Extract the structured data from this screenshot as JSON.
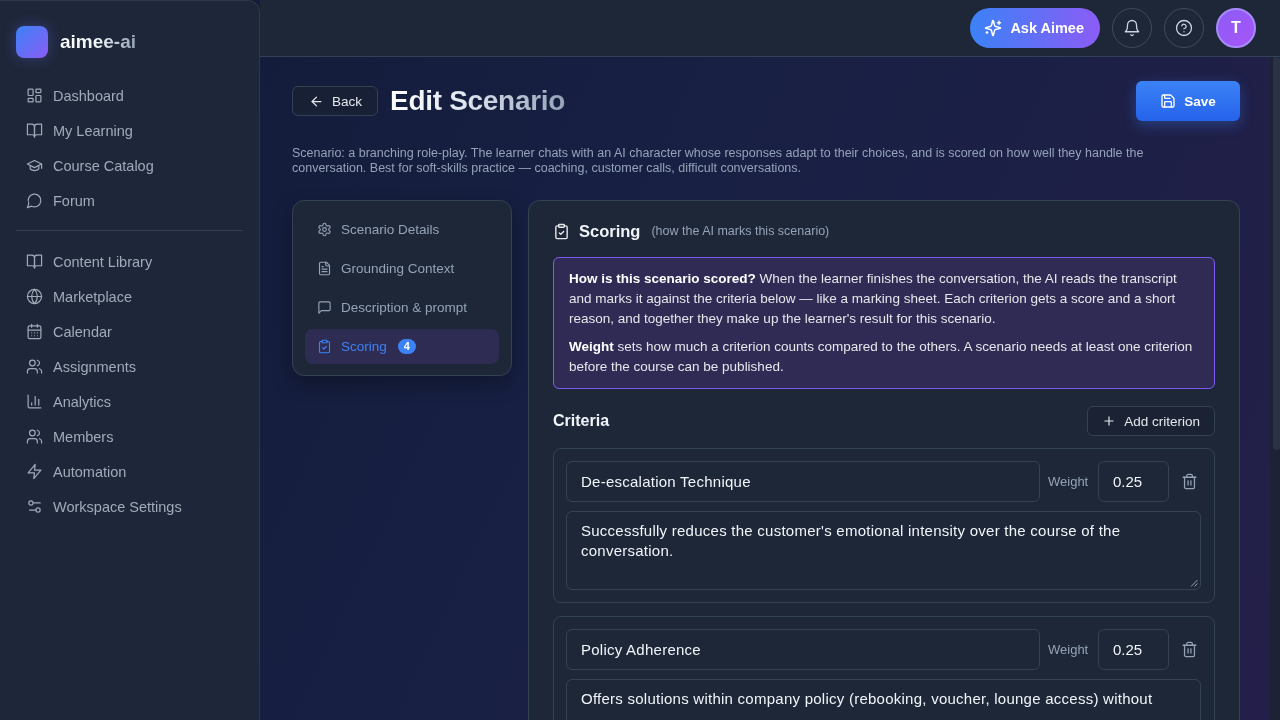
{
  "sidebar": {
    "brand": "aimee-ai",
    "sections": [
      {
        "items": [
          {
            "label": "Dashboard",
            "selected": false
          },
          {
            "label": "My Learning",
            "selected": false
          },
          {
            "label": "Course Catalog",
            "selected": false
          },
          {
            "label": "Forum",
            "selected": false
          }
        ]
      },
      {
        "items": [
          {
            "label": "Content Library",
            "selected": false
          },
          {
            "label": "Marketplace",
            "selected": false
          },
          {
            "label": "Calendar",
            "selected": false
          },
          {
            "label": "Assignments",
            "selected": false
          },
          {
            "label": "Analytics",
            "selected": false
          },
          {
            "label": "Members",
            "selected": false
          },
          {
            "label": "Automation",
            "selected": false
          },
          {
            "label": "Workspace Settings",
            "selected": false
          }
        ]
      }
    ]
  },
  "top_bar": {
    "ask_button": "Ask Aimee",
    "avatar": "T"
  },
  "header": {
    "back_button": "Back",
    "title": "Edit Scenario",
    "save_button": "Save",
    "description": "Scenario: a branching role-play. The learner chats with an AI character whose responses adapt to their choices, and is scored on how well they handle the conversation. Best for soft-skills practice — coaching, customer calls, difficult conversations."
  },
  "section_nav": {
    "items": [
      {
        "label": "Scenario Details",
        "selected": false
      },
      {
        "label": "Grounding Context",
        "selected": false
      },
      {
        "label": "Description & prompt",
        "selected": false
      },
      {
        "label": "Scoring",
        "selected": true,
        "badge": "4"
      }
    ]
  },
  "scoring": {
    "title": "Scoring",
    "subtitle": "(how the AI marks this scenario)",
    "info": [
      "**How is this scenario scored?** When the learner finishes the conversation, the AI reads the transcript and marks it against the criteria below — like a marking sheet. Each criterion gets a score and a short reason, and together they make up the learner's result for this scenario.",
      "**Weight** sets how much a criterion counts compared to the others. A scenario needs at least one criterion before the course can be published."
    ],
    "criteria_heading": "Criteria",
    "add_button": "Add criterion",
    "criteria": [
      {
        "name": "De-escalation Technique",
        "weight_label": "Weight",
        "weight": "0.25",
        "description": "Successfully reduces the customer's emotional intensity over the course of the conversation."
      },
      {
        "name": "Policy Adherence",
        "weight_label": "Weight",
        "weight": "0.25",
        "description": "Offers solutions within company policy (rebooking, voucher, lounge access) without"
      }
    ]
  }
}
